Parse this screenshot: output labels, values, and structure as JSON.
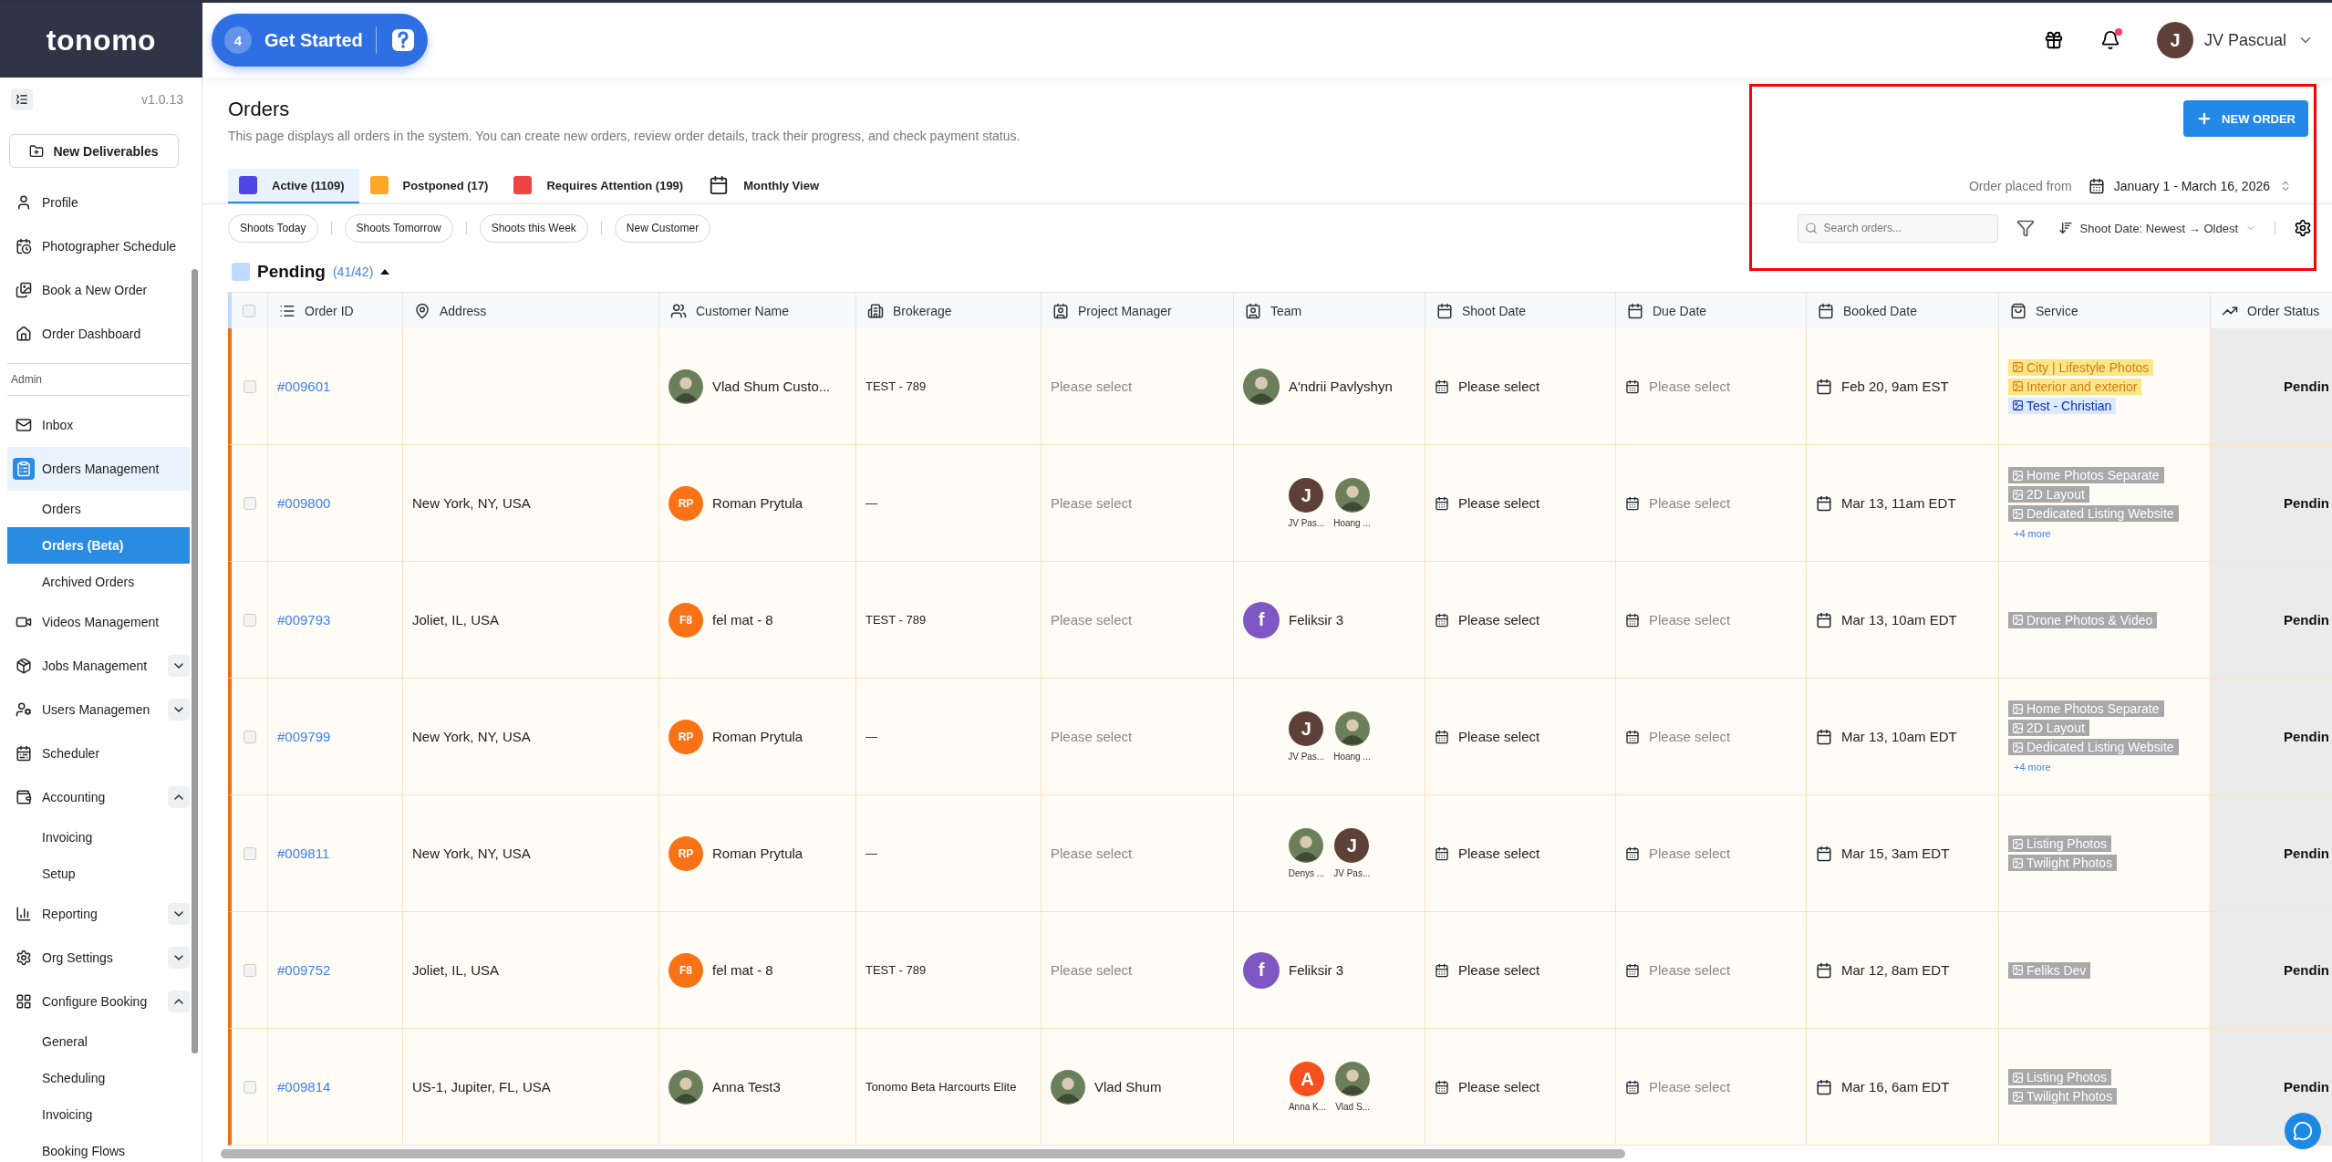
{
  "brand": {
    "name": "tonomo"
  },
  "get_started": {
    "count": "4",
    "label": "Get Started"
  },
  "user": {
    "initial": "J",
    "name": "JV Pascual",
    "notification": true
  },
  "sidebar": {
    "version": "v1.0.13",
    "action": "New Deliverables",
    "section_label": "Admin",
    "items": [
      {
        "label": "Profile",
        "selected": false
      },
      {
        "label": "Photographer Schedule",
        "selected": false
      },
      {
        "label": "Book a New Order",
        "selected": false
      },
      {
        "label": "Order Dashboard",
        "selected": false
      }
    ],
    "admin_items": [
      {
        "label": "Inbox",
        "selected": false
      },
      {
        "label": "Orders Management",
        "selected": true,
        "children": [
          {
            "label": "Orders",
            "selected": false
          },
          {
            "label": "Orders (Beta)",
            "selected": true
          },
          {
            "label": "Archived Orders",
            "selected": false
          }
        ]
      },
      {
        "label": "Videos Management",
        "selected": false
      },
      {
        "label": "Jobs Management",
        "selected": false,
        "expanded": false
      },
      {
        "label": "Users Managemen",
        "selected": false,
        "expanded": false
      },
      {
        "label": "Scheduler",
        "selected": false
      },
      {
        "label": "Accounting",
        "selected": false,
        "expanded": true,
        "children": [
          {
            "label": "Invoicing",
            "selected": false
          },
          {
            "label": "Setup",
            "selected": false
          }
        ]
      },
      {
        "label": "Reporting",
        "selected": false,
        "expanded": false
      },
      {
        "label": "Org Settings",
        "selected": false,
        "expanded": false
      },
      {
        "label": "Configure Booking",
        "selected": false,
        "expanded": true,
        "children": [
          {
            "label": "General",
            "selected": false
          },
          {
            "label": "Scheduling",
            "selected": false
          },
          {
            "label": "Invoicing",
            "selected": false
          },
          {
            "label": "Booking Flows",
            "selected": false
          }
        ]
      }
    ]
  },
  "page": {
    "title": "Orders",
    "description": "This page displays all orders in the system. You can create new orders, review order details, track their progress, and check payment status.",
    "new_order": "NEW ORDER"
  },
  "tabs": [
    {
      "label": "Active (1109)",
      "selected": true,
      "kind": "status",
      "color": "#5046e5"
    },
    {
      "label": "Postponed (17)",
      "selected": false,
      "kind": "status",
      "color": "#ffa726"
    },
    {
      "label": "Requires Attention (199)",
      "selected": false,
      "kind": "status",
      "color": "#ef4444"
    },
    {
      "label": "Monthly View",
      "selected": false,
      "kind": "calendar"
    }
  ],
  "date_filter": {
    "label": "Order placed from",
    "value": "January 1 - March 16, 2026"
  },
  "quick_filters": [
    "Shoots Today",
    "Shoots Tomorrow",
    "Shoots this Week",
    "New Customer"
  ],
  "search": {
    "placeholder": "Search orders..."
  },
  "sort": {
    "label": "Shoot Date: Newest → Oldest"
  },
  "group": {
    "title": "Pending",
    "count": "(41/42)",
    "expanded": true,
    "color": "#bfdbfe"
  },
  "table": {
    "select_all": {
      "checked": false
    },
    "columns": [
      "Order ID",
      "Address",
      "Customer Name",
      "Brokerage",
      "Project Manager",
      "Team",
      "Shoot Date",
      "Due Date",
      "Booked Date",
      "Service",
      "Order Status"
    ],
    "rows": [
      {
        "checked": false,
        "order_id": "#009601",
        "customer": {
          "name": "Vlad Shum Custo..."
        },
        "brokerage": "TEST - 789",
        "project_manager": {
          "placeholder": "Please select"
        },
        "team": [
          {
            "name": "A'ndrii Pavlyshyn"
          }
        ],
        "shoot_date": {
          "value": "Please select"
        },
        "due_date": {
          "placeholder": "Please select"
        },
        "booked_date": "Feb 20, 9am EST",
        "services": [
          {
            "label": "City | Lifestyle Photos",
            "color": "#fde68a"
          },
          {
            "label": "Interior and exterior",
            "color": "#fde68a"
          },
          {
            "label": "Test - Christian",
            "color": "#dbeafe"
          }
        ],
        "status": "Pendin"
      },
      {
        "checked": false,
        "order_id": "#009800",
        "address": "New York, NY, USA",
        "customer": {
          "name": "Roman Prytula",
          "initials": "RP",
          "color": "#f97316"
        },
        "brokerage": "—",
        "project_manager": {
          "placeholder": "Please select"
        },
        "team": [
          {
            "name": "JV Pas...",
            "initial": "J",
            "color": "#5d4037"
          },
          {
            "name": "Hoang ..."
          }
        ],
        "shoot_date": {
          "value": "Please select"
        },
        "due_date": {
          "placeholder": "Please select"
        },
        "booked_date": "Mar 13, 11am EDT",
        "services": [
          {
            "label": "Home Photos Separate",
            "color": "#a8a8a8"
          },
          {
            "label": "2D Layout",
            "color": "#a8a8a8"
          },
          {
            "label": "Dedicated Listing Website",
            "color": "#a8a8a8"
          }
        ],
        "more": "+4 more",
        "status": "Pendin"
      },
      {
        "checked": false,
        "order_id": "#009793",
        "address": "Joliet, IL, USA",
        "customer": {
          "name": "fel mat - 8",
          "initials": "F8",
          "color": "#f97316"
        },
        "brokerage": "TEST - 789",
        "project_manager": {
          "placeholder": "Please select"
        },
        "team": [
          {
            "name": "Feliksir 3",
            "initial": "f",
            "color": "#7e57c2"
          }
        ],
        "shoot_date": {
          "value": "Please select"
        },
        "due_date": {
          "placeholder": "Please select"
        },
        "booked_date": "Mar 13, 10am EDT",
        "services": [
          {
            "label": "Drone Photos & Video",
            "color": "#a8a8a8"
          }
        ],
        "status": "Pendin"
      },
      {
        "checked": false,
        "order_id": "#009799",
        "address": "New York, NY, USA",
        "customer": {
          "name": "Roman Prytula",
          "initials": "RP",
          "color": "#f97316"
        },
        "brokerage": "—",
        "project_manager": {
          "placeholder": "Please select"
        },
        "team": [
          {
            "name": "JV Pas...",
            "initial": "J",
            "color": "#5d4037"
          },
          {
            "name": "Hoang ..."
          }
        ],
        "shoot_date": {
          "value": "Please select"
        },
        "due_date": {
          "placeholder": "Please select"
        },
        "booked_date": "Mar 13, 10am EDT",
        "services": [
          {
            "label": "Home Photos Separate",
            "color": "#a8a8a8"
          },
          {
            "label": "2D Layout",
            "color": "#a8a8a8"
          },
          {
            "label": "Dedicated Listing Website",
            "color": "#a8a8a8"
          }
        ],
        "more": "+4 more",
        "status": "Pendin"
      },
      {
        "checked": false,
        "order_id": "#009811",
        "address": "New York, NY, USA",
        "customer": {
          "name": "Roman Prytula",
          "initials": "RP",
          "color": "#f97316"
        },
        "brokerage": "—",
        "project_manager": {
          "placeholder": "Please select"
        },
        "team": [
          {
            "name": "Denys ..."
          },
          {
            "name": "JV Pas...",
            "initial": "J",
            "color": "#5d4037"
          }
        ],
        "shoot_date": {
          "value": "Please select"
        },
        "due_date": {
          "placeholder": "Please select"
        },
        "booked_date": "Mar 15, 3am EDT",
        "services": [
          {
            "label": "Listing Photos",
            "color": "#a8a8a8"
          },
          {
            "label": "Twilight Photos",
            "color": "#a8a8a8"
          }
        ],
        "status": "Pendin"
      },
      {
        "checked": false,
        "order_id": "#009752",
        "address": "Joliet, IL, USA",
        "customer": {
          "name": "fel mat - 8",
          "initials": "F8",
          "color": "#f97316"
        },
        "brokerage": "TEST - 789",
        "project_manager": {
          "placeholder": "Please select"
        },
        "team": [
          {
            "name": "Feliksir 3",
            "initial": "f",
            "color": "#7e57c2"
          }
        ],
        "shoot_date": {
          "value": "Please select"
        },
        "due_date": {
          "placeholder": "Please select"
        },
        "booked_date": "Mar 12, 8am EDT",
        "services": [
          {
            "label": "Feliks Dev",
            "color": "#a8a8a8"
          }
        ],
        "status": "Pendin"
      },
      {
        "checked": false,
        "order_id": "#009814",
        "address": "US-1, Jupiter, FL, USA",
        "customer": {
          "name": "Anna Test3"
        },
        "brokerage": "Tonomo Beta Harcourts Elite",
        "project_manager": {
          "name": "Vlad Shum"
        },
        "team": [
          {
            "name": "Anna K...",
            "initial": "A",
            "color": "#f4511e"
          },
          {
            "name": "Vlad S..."
          }
        ],
        "shoot_date": {
          "value": "Please select"
        },
        "due_date": {
          "placeholder": "Please select"
        },
        "booked_date": "Mar 16, 6am EDT",
        "services": [
          {
            "label": "Listing Photos",
            "color": "#a8a8a8"
          },
          {
            "label": "Twilight Photos",
            "color": "#a8a8a8"
          }
        ],
        "status": "Pendin"
      }
    ]
  }
}
